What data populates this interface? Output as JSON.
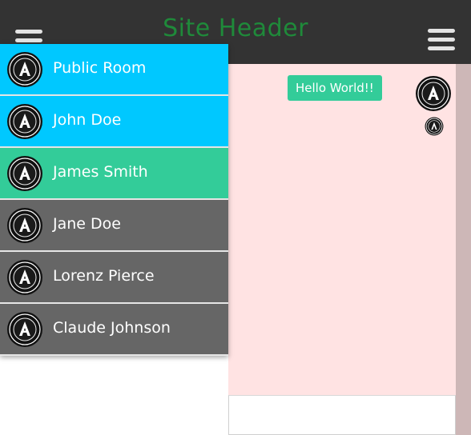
{
  "header": {
    "title": "Site Header",
    "title_color": "#1f8a3a",
    "background": "#333333",
    "left_menu_icon": "hamburger-menu-icon",
    "right_menu_icon": "hamburger-menu-icon"
  },
  "sidebar": {
    "items": [
      {
        "label": "Public Room",
        "color": "#00c8ff",
        "icon": "avatar-icon"
      },
      {
        "label": "John Doe",
        "color": "#00c8ff",
        "icon": "avatar-icon"
      },
      {
        "label": "James Smith",
        "color": "#33cc99",
        "icon": "avatar-icon"
      },
      {
        "label": "Jane Doe",
        "color": "#666666",
        "icon": "avatar-icon"
      },
      {
        "label": "Lorenz Pierce",
        "color": "#666666",
        "icon": "avatar-icon"
      },
      {
        "label": "Claude Johnson",
        "color": "#666666",
        "icon": "avatar-icon"
      }
    ]
  },
  "chat": {
    "background": "#ffe3e3",
    "messages": [
      {
        "text": "Hello World!!",
        "color": "#33cc99"
      }
    ]
  }
}
